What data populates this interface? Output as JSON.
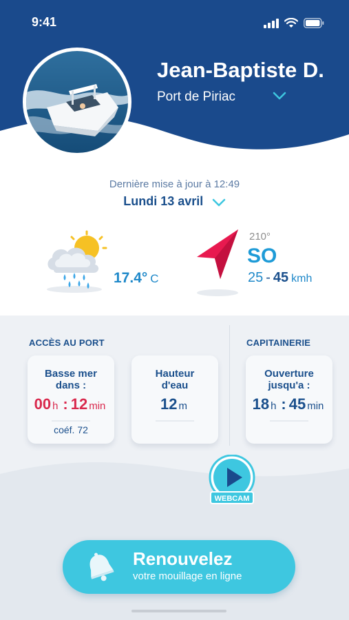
{
  "status_bar": {
    "time": "9:41"
  },
  "profile": {
    "name": "Jean-Baptiste D.",
    "port": "Port de Piriac"
  },
  "update": {
    "text": "Dernière mise à jour à 12:49",
    "date": "Lundi 13 avril"
  },
  "weather": {
    "temperature": "17.4°",
    "unit": "C",
    "icon": "rain-sun-cloud-icon"
  },
  "wind": {
    "degrees": "210°",
    "direction": "SO",
    "speed_min": "25",
    "speed_max": "45",
    "unit": "kmh",
    "icon": "wind-arrow-icon"
  },
  "port_access": {
    "title": "ACCÈS AU PORT",
    "low_tide": {
      "title_line1": "Basse mer",
      "title_line2": "dans :",
      "hours": "00",
      "hours_unit": "h",
      "separator": ":",
      "minutes": "12",
      "minutes_unit": "min",
      "coef": "coéf. 72"
    },
    "water_height": {
      "title_line1": "Hauteur",
      "title_line2": "d'eau",
      "value": "12",
      "unit": "m"
    }
  },
  "harbor_office": {
    "title": "CAPITAINERIE",
    "opening": {
      "title_line1": "Ouverture",
      "title_line2": "jusqu'a :",
      "hours": "18",
      "hours_unit": "h",
      "separator": ":",
      "minutes": "45",
      "minutes_unit": "min"
    }
  },
  "webcam": {
    "label": "WEBCAM"
  },
  "cta": {
    "title": "Renouvelez",
    "subtitle": "votre mouillage en ligne"
  },
  "colors": {
    "header_blue": "#1a4a8c",
    "accent_cyan": "#3ec7e0",
    "alert_red": "#d9294d",
    "wind_red": "#e8194f"
  }
}
